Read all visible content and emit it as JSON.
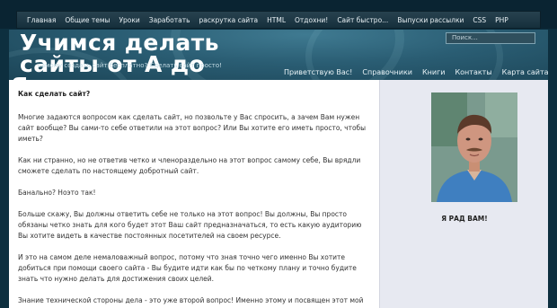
{
  "top_nav": [
    "Главная",
    "Общие темы",
    "Уроки",
    "Заработать",
    "раскрутка сайта",
    "HTML",
    "Отдохни!",
    "Сайт быстро...",
    "Выпуски рассылки",
    "CSS",
    "PHP"
  ],
  "header": {
    "title_line1": "Учимся делать сайты от А до",
    "title_line2": "Я",
    "tagline": "самому создать сайт бесплатно? Сделать сайт просто!",
    "search_placeholder": "Поиск..."
  },
  "main_nav": [
    "Приветствую Вас!",
    "Справочники",
    "Книги",
    "Контакты",
    "Карта сайта"
  ],
  "content": {
    "heading": "Как сделать сайт?",
    "paragraphs": [
      "Многие задаются вопросом как сделать сайт, но позвольте у Вас спросить, а зачем Вам нужен сайт вообще? Вы сами-то себе ответили на этот вопрос? Или Вы хотите его иметь просто, чтобы иметь?",
      "Как ни странно, но не ответив четко и членораздельно на этот вопрос самому себе, Вы врядли сможете сделать по настоящему добротный сайт.",
      "Банально? Ноэто так!",
      "Больше скажу, Вы должны ответить себе не только на этот вопрос! Вы должны, Вы просто обязаны четко знать для кого будет этот Ваш сайт предназначаться, то есть какую аудиторию Вы хотите видеть в качестве постоянных посетителей на своем ресурсе.",
      "И это на самом деле немаловажный вопрос, потому что зная точно чего именно Вы хотите добиться при помощи своего сайта - Вы будите идти как бы по четкому плану и точно будите знать что нужно делать для достижения своих целей.",
      "Знание технической стороны дела - это уже второй вопрос! Именно этому и посвящен этот мой сайт. И здесь Вы можете найти много полезной информации."
    ]
  },
  "sidebar": {
    "caption": "Я РАД ВАМ!"
  }
}
